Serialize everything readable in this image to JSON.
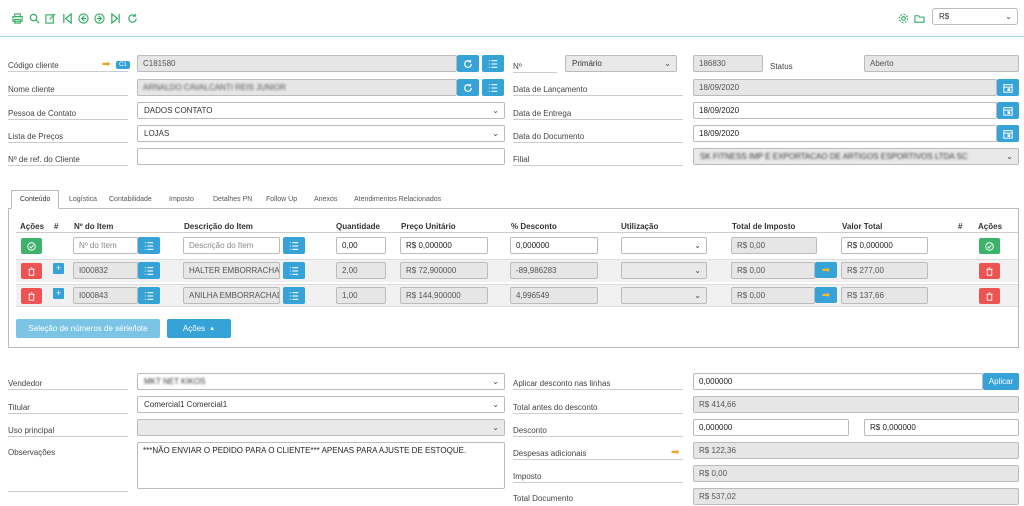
{
  "toolbar": {
    "icons": [
      "printer-icon",
      "search-icon",
      "edit-icon",
      "first-icon",
      "prev-icon",
      "next-icon",
      "last-icon",
      "refresh-icon"
    ],
    "right_icons": [
      "gear-icon",
      "folder-icon"
    ],
    "currency": "R$"
  },
  "header": {
    "codigo_cliente": {
      "label": "Código cliente",
      "badge": "C1",
      "value": "C181580"
    },
    "nome_cliente": {
      "label": "Nome cliente",
      "value": "ARNALDO CAVALCANTI REIS JUNIOR"
    },
    "pessoa_contato": {
      "label": "Pessoa de Contato",
      "value": "DADOS CONTATO"
    },
    "lista_precos": {
      "label": "Lista de Preços",
      "value": "LOJAS"
    },
    "ref_cliente": {
      "label": "Nº de ref. do Cliente",
      "value": ""
    },
    "numero": {
      "label": "Nº",
      "series": "Primário",
      "value": "186830"
    },
    "status": {
      "label": "Status",
      "value": "Aberto"
    },
    "data_lancamento": {
      "label": "Data de Lançamento",
      "value": "18/09/2020"
    },
    "data_entrega": {
      "label": "Data de Entrega",
      "value": "18/09/2020"
    },
    "data_documento": {
      "label": "Data do Documento",
      "value": "18/09/2020"
    },
    "filial": {
      "label": "Filial",
      "value": "SK FITNESS IMP E EXPORTACAO DE ARTIGOS ESPORTIVOS LTDA SC"
    }
  },
  "tabs": [
    "Conteúdo",
    "Logística",
    "Contabilidade",
    "Imposto",
    "Detalhes PN",
    "Follow Up",
    "Anexos",
    "Atendimentos Relacionados"
  ],
  "table": {
    "columns": [
      "Ações",
      "#",
      "Nº do Item",
      "Descrição do Item",
      "Quantidade",
      "Preço Unitário",
      "% Desconto",
      "Utilização",
      "Total de Imposto",
      "Valor Total",
      "#",
      "Ações"
    ],
    "new_row": {
      "item_placeholder": "Nº do Item",
      "desc_placeholder": "Descrição do Item",
      "quantidade": "0,00",
      "preco": "R$ 0,000000",
      "desconto": "0,000000",
      "imposto": "R$ 0,00",
      "total": "R$ 0,000000"
    },
    "rows": [
      {
        "item": "I000832",
        "desc": "HALTER EMBORRACHADO",
        "quantidade": "2,00",
        "preco": "R$ 72,900000",
        "desconto": "-89,986283",
        "imposto": "R$ 0,00",
        "total": "R$ 277,00"
      },
      {
        "item": "I000843",
        "desc": "ANILHA EMBORRACHADO",
        "quantidade": "1,00",
        "preco": "R$ 144,900000",
        "desconto": "4,996549",
        "imposto": "R$ 0,00",
        "total": "R$ 137,66"
      }
    ],
    "serial_button": "Seleção de números de série/lote",
    "actions_button": "Ações"
  },
  "footer": {
    "vendedor": {
      "label": "Vendedor",
      "value": "MKT NET KIKOS"
    },
    "titular": {
      "label": "Titular",
      "value": "Comercial1 Comercial1"
    },
    "uso_principal": {
      "label": "Uso principal",
      "value": ""
    },
    "observacoes": {
      "label": "Observações",
      "value": "***NÃO ENVIAR O PEDIDO PARA O CLIENTE*** APENAS PARA AJUSTE DE ESTOQUE."
    },
    "aplicar_desconto": {
      "label": "Aplicar desconto nas linhas",
      "value": "0,000000",
      "button": "Aplicar"
    },
    "total_antes": {
      "label": "Total antes do desconto",
      "value": "R$ 414,66"
    },
    "desconto": {
      "label": "Desconto",
      "value": "0,000000",
      "value2": "R$ 0,000000"
    },
    "despesas": {
      "label": "Despesas adicionais",
      "value": "R$ 122,36"
    },
    "imposto": {
      "label": "Imposto",
      "value": "R$ 0,00"
    },
    "total_documento": {
      "label": "Total Documento",
      "value": "R$ 537,02"
    }
  }
}
